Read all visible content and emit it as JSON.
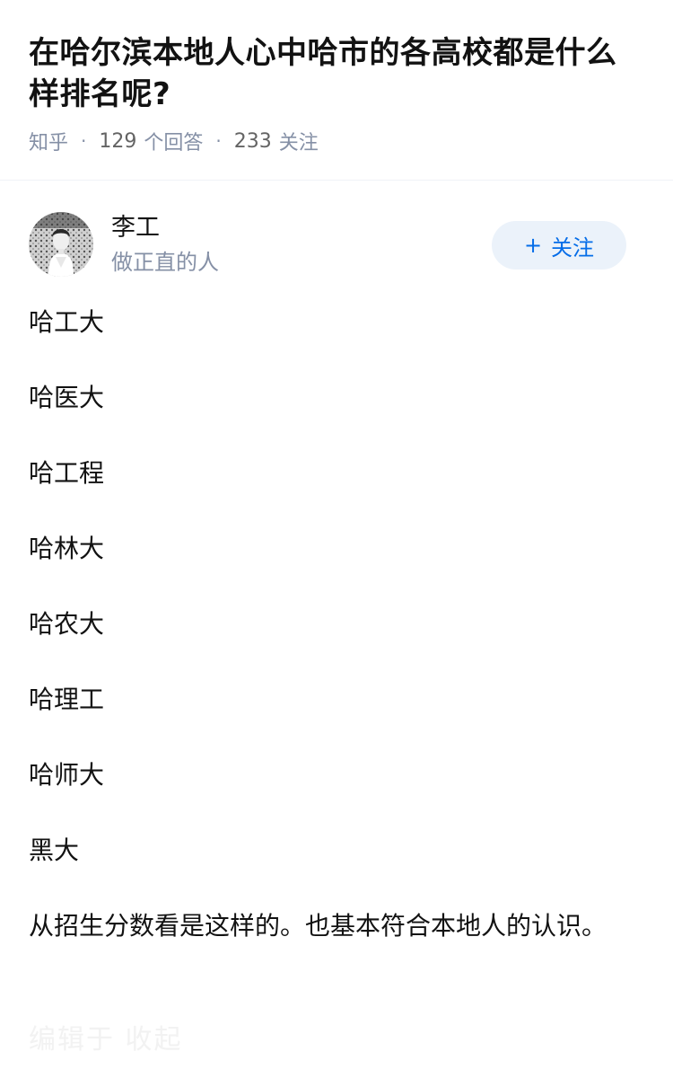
{
  "question": {
    "title": "在哈尔滨本地人心中哈市的各高校都是什么样排名呢?",
    "source": "知乎",
    "answer_count": "129",
    "answer_label": "个回答",
    "follow_count": "233",
    "follow_label": "关注"
  },
  "author": {
    "name": "李工",
    "bio": "做正直的人",
    "follow_button_label": "关注",
    "follow_button_icon": "plus-icon"
  },
  "answer": {
    "paragraphs": [
      "哈工大",
      "哈医大",
      "哈工程",
      "哈林大",
      "哈农大",
      "哈理工",
      "哈师大",
      "黑大",
      "从招生分数看是这样的。也基本符合本地人的认识。"
    ]
  },
  "footer": {
    "faded_text": "编辑于 收起"
  },
  "colors": {
    "text": "#121212",
    "meta": "#8590a6",
    "brand_blue": "#056de8",
    "follow_bg": "#ebf2fa",
    "divider": "#f0f2f7"
  }
}
